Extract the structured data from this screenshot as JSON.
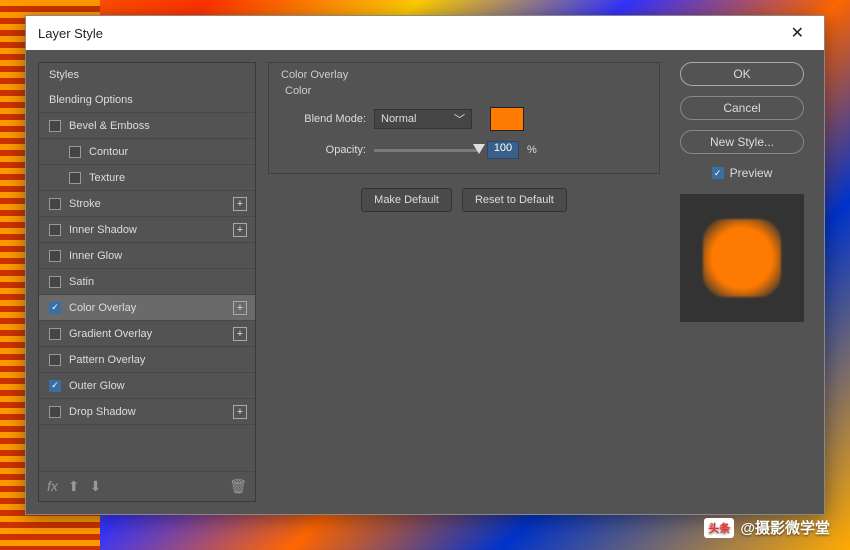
{
  "dialog": {
    "title": "Layer Style"
  },
  "styles_header": "Styles",
  "styles": [
    {
      "label": "Blending Options",
      "kind": "plain"
    },
    {
      "label": "Bevel & Emboss",
      "kind": "check"
    },
    {
      "label": "Contour",
      "kind": "check",
      "sub": true
    },
    {
      "label": "Texture",
      "kind": "check",
      "sub": true
    },
    {
      "label": "Stroke",
      "kind": "check",
      "plus": true
    },
    {
      "label": "Inner Shadow",
      "kind": "check",
      "plus": true
    },
    {
      "label": "Inner Glow",
      "kind": "check"
    },
    {
      "label": "Satin",
      "kind": "check"
    },
    {
      "label": "Color Overlay",
      "kind": "check",
      "checked": true,
      "plus": true,
      "selected": true
    },
    {
      "label": "Gradient Overlay",
      "kind": "check",
      "plus": true
    },
    {
      "label": "Pattern Overlay",
      "kind": "check"
    },
    {
      "label": "Outer Glow",
      "kind": "check",
      "checked": true
    },
    {
      "label": "Drop Shadow",
      "kind": "check",
      "plus": true
    }
  ],
  "settings": {
    "group_title": "Color Overlay",
    "color_label": "Color",
    "blend_mode_label": "Blend Mode:",
    "blend_mode_value": "Normal",
    "opacity_label": "Opacity:",
    "opacity_value": "100",
    "opacity_unit": "%",
    "swatch_color": "#ff7a00",
    "make_default": "Make Default",
    "reset_default": "Reset to Default"
  },
  "right": {
    "ok": "OK",
    "cancel": "Cancel",
    "new_style": "New Style...",
    "preview": "Preview",
    "preview_checked": true
  },
  "watermark": {
    "badge": "头条",
    "text": "@摄影微学堂"
  }
}
